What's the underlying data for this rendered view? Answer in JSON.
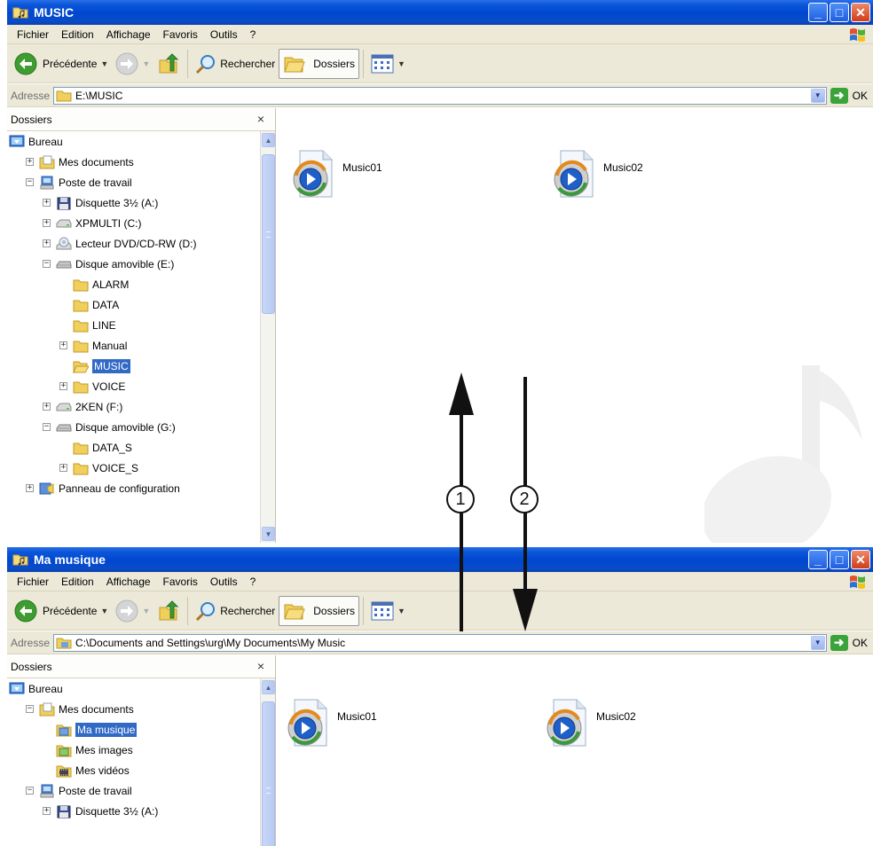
{
  "top_window": {
    "title": "MUSIC",
    "menu": [
      {
        "label": "Fichier"
      },
      {
        "label": "Edition"
      },
      {
        "label": "Affichage"
      },
      {
        "label": "Favoris"
      },
      {
        "label": "Outils"
      },
      {
        "label": "?"
      }
    ],
    "toolbar": {
      "back": "Précédente",
      "search": "Rechercher",
      "folders": "Dossiers"
    },
    "address": {
      "label": "Adresse",
      "path": "E:\\MUSIC",
      "go": "OK"
    },
    "folders_pane": {
      "title": "Dossiers",
      "close_glyph": "×",
      "tree": [
        {
          "label": "Bureau",
          "depth": 0,
          "expander": "none",
          "icon": "desktop-icon"
        },
        {
          "label": "Mes documents",
          "depth": 1,
          "expander": "plus",
          "icon": "documents-folder-icon"
        },
        {
          "label": "Poste de travail",
          "depth": 1,
          "expander": "minus",
          "icon": "computer-icon"
        },
        {
          "label": "Disquette 3½ (A:)",
          "depth": 2,
          "expander": "plus",
          "icon": "floppy-icon"
        },
        {
          "label": "XPMULTI (C:)",
          "depth": 2,
          "expander": "plus",
          "icon": "drive-icon"
        },
        {
          "label": "Lecteur DVD/CD-RW (D:)",
          "depth": 2,
          "expander": "plus",
          "icon": "cd-drive-icon"
        },
        {
          "label": "Disque amovible (E:)",
          "depth": 2,
          "expander": "minus",
          "icon": "removable-drive-icon"
        },
        {
          "label": "ALARM",
          "depth": 3,
          "expander": "none",
          "icon": "folder-icon"
        },
        {
          "label": "DATA",
          "depth": 3,
          "expander": "none",
          "icon": "folder-icon"
        },
        {
          "label": "LINE",
          "depth": 3,
          "expander": "none",
          "icon": "folder-icon"
        },
        {
          "label": "Manual",
          "depth": 3,
          "expander": "plus",
          "icon": "folder-icon"
        },
        {
          "label": "MUSIC",
          "depth": 3,
          "expander": "none",
          "icon": "open-folder-icon",
          "selected": true
        },
        {
          "label": "VOICE",
          "depth": 3,
          "expander": "plus",
          "icon": "folder-icon"
        },
        {
          "label": "2KEN (F:)",
          "depth": 2,
          "expander": "plus",
          "icon": "drive-icon"
        },
        {
          "label": "Disque amovible (G:)",
          "depth": 2,
          "expander": "minus",
          "icon": "removable-drive-icon"
        },
        {
          "label": "DATA_S",
          "depth": 3,
          "expander": "none",
          "icon": "folder-icon"
        },
        {
          "label": "VOICE_S",
          "depth": 3,
          "expander": "plus",
          "icon": "folder-icon"
        },
        {
          "label": "Panneau de configuration",
          "depth": 1,
          "expander": "plus",
          "icon": "control-panel-icon"
        }
      ]
    },
    "files": [
      {
        "name": "Music01",
        "icon": "media-player-file-icon"
      },
      {
        "name": "Music02",
        "icon": "media-player-file-icon"
      }
    ]
  },
  "bottom_window": {
    "title": "Ma musique",
    "menu": [
      {
        "label": "Fichier"
      },
      {
        "label": "Edition"
      },
      {
        "label": "Affichage"
      },
      {
        "label": "Favoris"
      },
      {
        "label": "Outils"
      },
      {
        "label": "?"
      }
    ],
    "toolbar": {
      "back": "Précédente",
      "search": "Rechercher",
      "folders": "Dossiers"
    },
    "address": {
      "label": "Adresse",
      "path": "C:\\Documents and Settings\\urg\\My Documents\\My Music",
      "go": "OK"
    },
    "folders_pane": {
      "title": "Dossiers",
      "close_glyph": "×",
      "tree": [
        {
          "label": "Bureau",
          "depth": 0,
          "expander": "none",
          "icon": "desktop-icon"
        },
        {
          "label": "Mes documents",
          "depth": 1,
          "expander": "minus",
          "icon": "documents-folder-icon"
        },
        {
          "label": "Ma musique",
          "depth": 2,
          "expander": "none",
          "icon": "music-folder-icon",
          "selected": true
        },
        {
          "label": "Mes images",
          "depth": 2,
          "expander": "none",
          "icon": "pictures-folder-icon"
        },
        {
          "label": "Mes vidéos",
          "depth": 2,
          "expander": "none",
          "icon": "videos-folder-icon"
        },
        {
          "label": "Poste de travail",
          "depth": 1,
          "expander": "minus",
          "icon": "computer-icon"
        },
        {
          "label": "Disquette 3½ (A:)",
          "depth": 2,
          "expander": "plus",
          "icon": "floppy-icon"
        }
      ]
    },
    "files": [
      {
        "name": "Music01",
        "icon": "media-player-file-icon"
      },
      {
        "name": "Music02",
        "icon": "media-player-file-icon"
      }
    ]
  },
  "callouts": [
    {
      "label": "1",
      "direction": "up"
    },
    {
      "label": "2",
      "direction": "down"
    }
  ],
  "colors": {
    "titlebar_blue": "#0046d0",
    "selection_blue": "#316ac5",
    "chrome_beige": "#ece9d8",
    "close_red": "#cf3d1a",
    "go_green": "#3aa33a"
  }
}
